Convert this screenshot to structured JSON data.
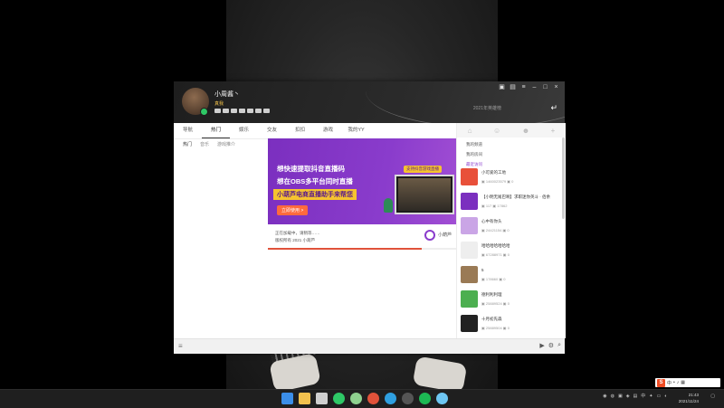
{
  "profile": {
    "name": "小周酱丶",
    "tag": "真我",
    "status_color": "#2ec866"
  },
  "header": {
    "slogan": "2021年英雄榜",
    "window_controls": [
      "pin-icon",
      "skin-icon",
      "menu-icon",
      "minimize-icon",
      "maximize-icon",
      "close-icon"
    ]
  },
  "tabs": [
    {
      "label": "导航",
      "active": false
    },
    {
      "label": "热门",
      "active": true
    },
    {
      "label": "娱乐",
      "active": false
    },
    {
      "label": "交友",
      "active": false
    },
    {
      "label": "扣扣",
      "active": false
    },
    {
      "label": "游戏",
      "active": false
    },
    {
      "label": "我的YY",
      "active": false
    }
  ],
  "subtabs": [
    "热门",
    "音乐",
    "游戏推介"
  ],
  "banner": {
    "line1": "想快速提取抖音直播码",
    "line2": "想在OBS多平台同时直播",
    "line3": "小葫芦电商直播助手来帮您",
    "button": "立即使用 >",
    "tag": "支持抖音游戏直播",
    "accent": "#8a3ccc"
  },
  "loading": {
    "line1": "正在加载中，请稍等……",
    "line2": "版权所有 2021 小葫芦",
    "brand": "小葫芦",
    "progress": 0.8
  },
  "right_panel": {
    "menu": [
      {
        "label": "我的频道",
        "active": false
      },
      {
        "label": "我的房间",
        "active": false
      },
      {
        "label": "最近访问",
        "active": true
      }
    ],
    "items": [
      {
        "name": "小可爱的工地",
        "stat_a": "1460023579",
        "stat_b": "0",
        "color": "#e8503a"
      },
      {
        "name": "【小明无尾巴啊】求职迷你英斗 · 佰余",
        "stat_a": "117",
        "stat_b": "17862",
        "color": "#7b2fbf"
      },
      {
        "name": "心中有你头",
        "stat_a": "24421154",
        "stat_b": "0",
        "color": "#caa5e6"
      },
      {
        "name": "哈哈哈哈哈哈哈",
        "stat_a": "67288971",
        "stat_b": "0",
        "color": "#eeeeee"
      },
      {
        "name": "5",
        "stat_a": "178660",
        "stat_b": "0",
        "color": "#9a7a55"
      },
      {
        "name": "德利利利理",
        "stat_a": "25889524",
        "stat_b": "0",
        "color": "#4caf50"
      },
      {
        "name": "十月初先森",
        "stat_a": "25889504",
        "stat_b": "0",
        "color": "#222222"
      }
    ]
  },
  "taskbar": {
    "time": "21:43",
    "date": "2021/11/24",
    "ime_label": "中"
  }
}
